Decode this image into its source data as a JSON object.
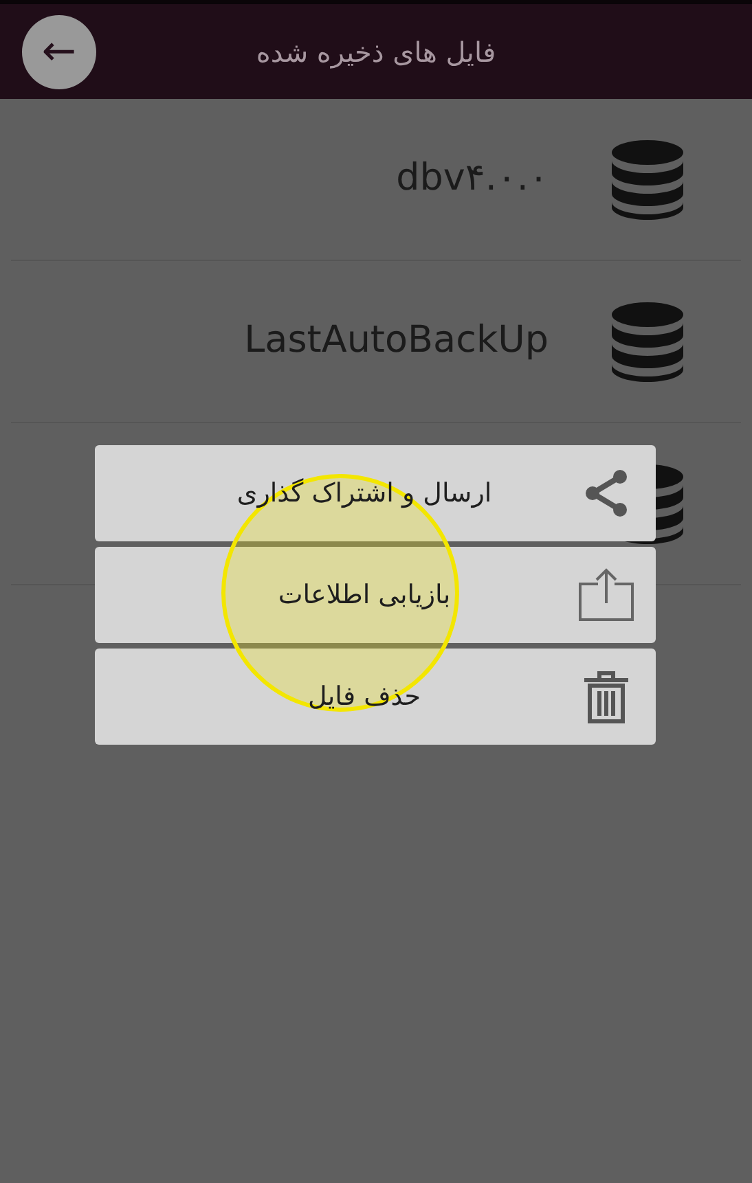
{
  "header": {
    "title": "فایل های ذخیره شده",
    "back_label": "←"
  },
  "files": [
    {
      "kind": "database",
      "name": "dbv۴.۰.۰"
    },
    {
      "kind": "database",
      "name": "LastAutoBackUp"
    },
    {
      "kind": "database"
    }
  ],
  "menu": [
    {
      "kind": "share",
      "label": "ارسال و اشتراک گذاری"
    },
    {
      "kind": "restore",
      "label": "بازیابی اطلاعات"
    },
    {
      "kind": "delete",
      "label": "حذف فایل"
    }
  ],
  "touch_indicator": {
    "kind": "tap"
  }
}
